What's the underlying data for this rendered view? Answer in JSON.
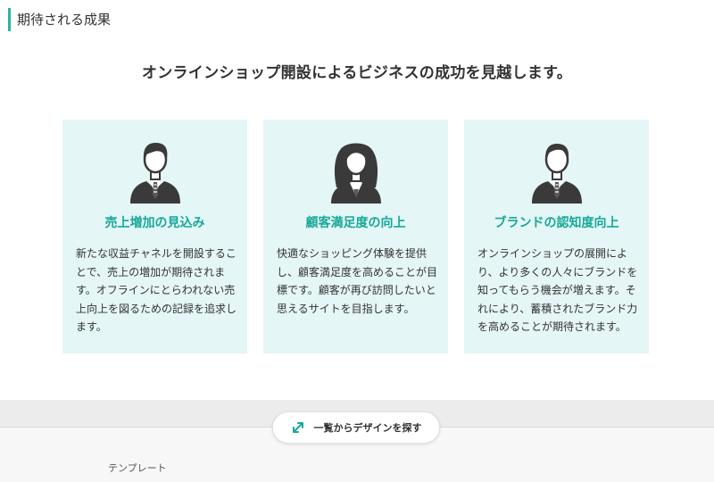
{
  "section": {
    "title": "期待される成果"
  },
  "headline": "オンラインショップ開設によるビジネスの成功を見越します。",
  "cards": [
    {
      "icon": "businessman-icon",
      "title": "売上増加の見込み",
      "body": "新たな収益チャネルを開設することで、売上の増加が期待されます。オフラインにとらわれない売上向上を図るための記録を追求します。"
    },
    {
      "icon": "businesswoman-icon",
      "title": "顧客満足度の向上",
      "body": "快適なショッピング体験を提供し、顧客満足度を高めることが目標です。顧客が再び訪問したいと思えるサイトを目指します。"
    },
    {
      "icon": "businessman-icon",
      "title": "ブランドの認知度向上",
      "body": "オンラインショップの展開により、より多くの人々にブランドを知ってもらう機会が増えます。それにより、蓄積されたブランド力を高めることが期待されます。"
    }
  ],
  "browse_button": {
    "label": "一覧からデザインを探す",
    "icon": "expand-arrows-icon"
  },
  "bottom": {
    "tab_label": "テンプレート"
  },
  "colors": {
    "accent": "#17a89a",
    "card_bg": "#e4f6f5",
    "avatar": "#3a3a3a"
  }
}
